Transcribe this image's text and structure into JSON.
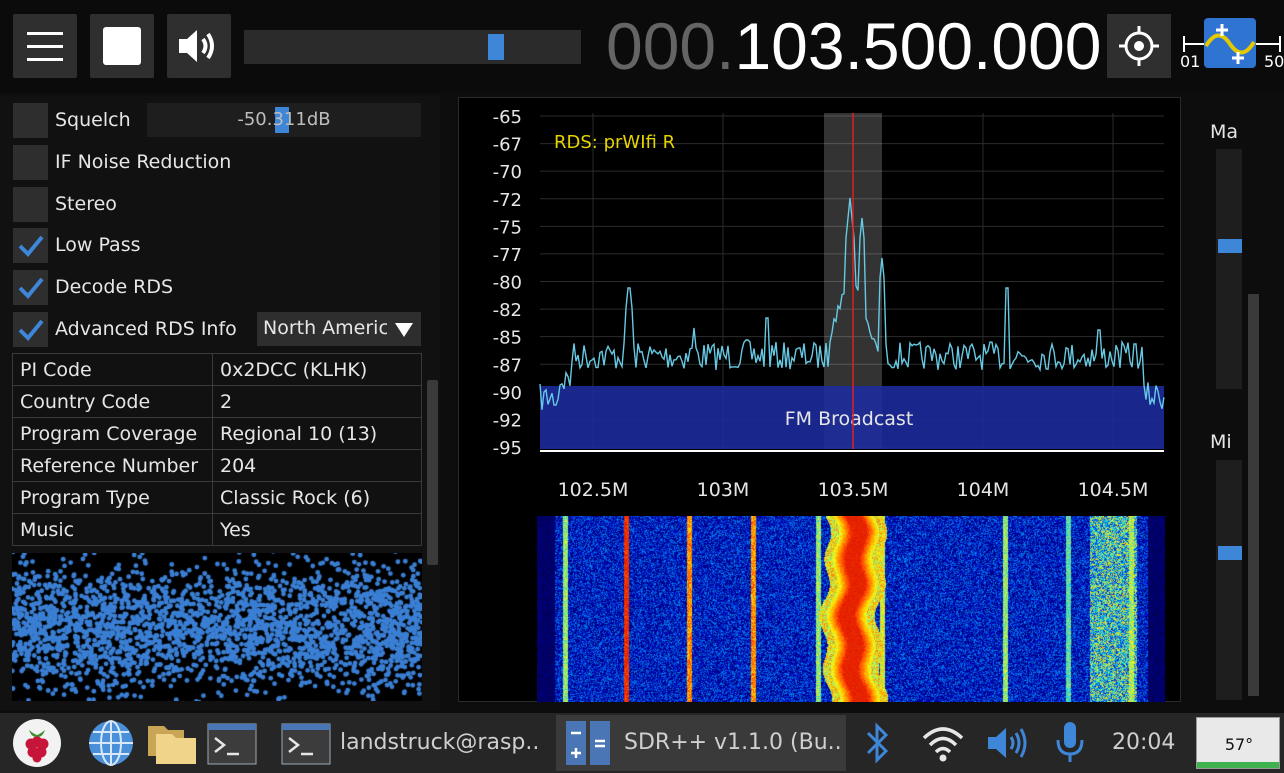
{
  "topbar": {
    "frequency_dim": "000.",
    "frequency_main": "103.500.000",
    "volume_level": 0.76,
    "mini_tuner_left": "01",
    "mini_tuner_right": "50"
  },
  "options": {
    "squelch_label": "Squelch",
    "squelch_value": "-50.311dB",
    "squelch_level": 0.5,
    "if_noise_label": "IF Noise Reduction",
    "stereo_label": "Stereo",
    "low_pass_label": "Low Pass",
    "decode_rds_label": "Decode RDS",
    "advanced_rds_label": "Advanced RDS Info",
    "region_selected": "North America"
  },
  "rds_info": [
    {
      "key": "PI Code",
      "value": "0x2DCC (KLHK)"
    },
    {
      "key": "Country Code",
      "value": "2"
    },
    {
      "key": "Program Coverage",
      "value": "Regional 10 (13)"
    },
    {
      "key": "Reference Number",
      "value": "204"
    },
    {
      "key": "Program Type",
      "value": "Classic Rock (6)"
    },
    {
      "key": "Music",
      "value": "Yes"
    }
  ],
  "spectrum": {
    "rds_overlay": "RDS: prWIfi R",
    "band_label": "FM Broadcast",
    "y_ticks": [
      "-65",
      "-67",
      "-70",
      "-72",
      "-75",
      "-77",
      "-80",
      "-82",
      "-85",
      "-87",
      "-90",
      "-92",
      "-95"
    ],
    "x_ticks": [
      "102.5M",
      "103M",
      "103.5M",
      "104M",
      "104.5M"
    ],
    "center_mhz": 103.5
  },
  "right_panel": {
    "max_label": "Ma",
    "min_label": "Mi",
    "max_level": 0.4,
    "min_level": 0.38
  },
  "taskbar": {
    "terminal_task": "landstruck@rasp..",
    "sdr_task": "SDR++ v1.1.0 (Bu..",
    "clock": "20:04",
    "cpu_temp": "57°"
  },
  "colors": {
    "accent": "#3d86d8",
    "spectrum_line": "#67c9e3",
    "band_fill": "#1c2b9e",
    "tuner_line": "#e02020",
    "rds_text": "#e6d400"
  }
}
